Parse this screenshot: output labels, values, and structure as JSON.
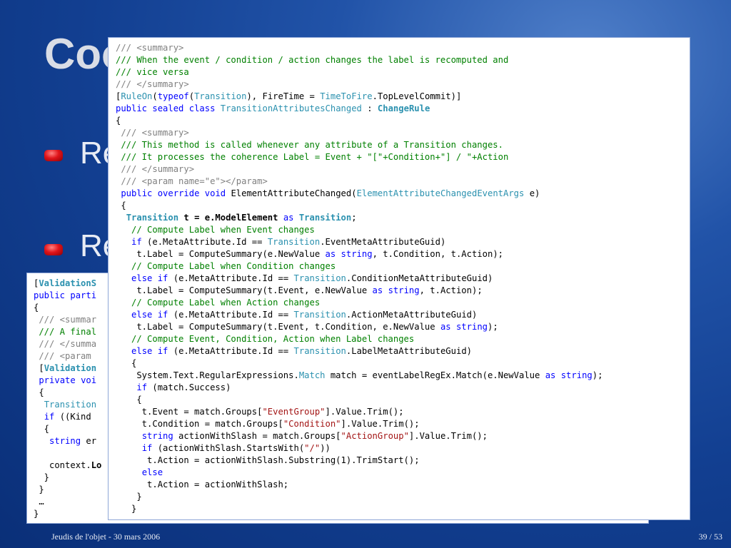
{
  "slide": {
    "title": "Coo",
    "bullets": [
      "Re",
      "Re"
    ],
    "footer_left": "Jeudis de l'objet - 30 mars 2006",
    "footer_right": "39 / 53"
  },
  "back_code": [
    [
      [
        "[",
        ""
      ],
      [
        "ValidationS",
        "bt"
      ]
    ],
    [
      [
        "public",
        "k"
      ],
      [
        " ",
        ""
      ],
      [
        "parti",
        "k"
      ]
    ],
    [
      [
        "{",
        ""
      ]
    ],
    [
      [
        " /// <summar",
        "x"
      ]
    ],
    [
      [
        " /// A final",
        "c"
      ]
    ],
    [
      [
        " /// </summa",
        "x"
      ]
    ],
    [
      [
        " /// <param ",
        "x"
      ]
    ],
    [
      [
        " [",
        ""
      ],
      [
        "Validation",
        "bt"
      ]
    ],
    [
      [
        " ",
        ""
      ],
      [
        "private",
        "k"
      ],
      [
        " ",
        ""
      ],
      [
        "voi",
        "k"
      ]
    ],
    [
      [
        " {",
        ""
      ]
    ],
    [
      [
        "  ",
        ""
      ],
      [
        "Transition",
        "t"
      ]
    ],
    [
      [
        "  ",
        ""
      ],
      [
        "if",
        "k"
      ],
      [
        " ((Kind ",
        ""
      ]
    ],
    [
      [
        "  {",
        ""
      ]
    ],
    [
      [
        "   ",
        ""
      ],
      [
        "string",
        "k"
      ],
      [
        " er",
        ""
      ]
    ],
    [
      [
        "",
        ""
      ]
    ],
    [
      [
        "   context.",
        ""
      ],
      [
        "Lo",
        "b"
      ]
    ],
    [
      [
        "  }",
        ""
      ]
    ],
    [
      [
        " }",
        ""
      ]
    ],
    [
      [
        " …",
        ""
      ]
    ],
    [
      [
        "}",
        ""
      ]
    ]
  ],
  "front_code": [
    [
      [
        "/// <summary>",
        "x"
      ]
    ],
    [
      [
        "/// When the event / condition / action changes the label is recomputed and",
        "c"
      ]
    ],
    [
      [
        "/// vice versa",
        "c"
      ]
    ],
    [
      [
        "/// </summary>",
        "x"
      ]
    ],
    [
      [
        "[",
        ""
      ],
      [
        "RuleOn",
        "t"
      ],
      [
        "(",
        ""
      ],
      [
        "typeof",
        "k"
      ],
      [
        "(",
        ""
      ],
      [
        "Transition",
        "t"
      ],
      [
        "), FireTime = ",
        ""
      ],
      [
        "TimeToFire",
        "t"
      ],
      [
        ".TopLevelCommit)]",
        ""
      ]
    ],
    [
      [
        "public",
        "k"
      ],
      [
        " ",
        ""
      ],
      [
        "sealed",
        "k"
      ],
      [
        " ",
        ""
      ],
      [
        "class",
        "k"
      ],
      [
        " ",
        ""
      ],
      [
        "TransitionAttributesChanged",
        "t"
      ],
      [
        " : ",
        ""
      ],
      [
        "ChangeRule",
        "bt"
      ]
    ],
    [
      [
        "{",
        ""
      ]
    ],
    [
      [
        " /// <summary>",
        "x"
      ]
    ],
    [
      [
        " /// This method is called whenever any attribute of a Transition changes.",
        "c"
      ]
    ],
    [
      [
        " /// It processes the coherence Label = Event + \"[\"+Condition+\"] / \"+Action",
        "c"
      ]
    ],
    [
      [
        " /// </summary>",
        "x"
      ]
    ],
    [
      [
        " /// <param name=\"e\"></param>",
        "x"
      ]
    ],
    [
      [
        " ",
        ""
      ],
      [
        "public",
        "k"
      ],
      [
        " ",
        ""
      ],
      [
        "override",
        "k"
      ],
      [
        " ",
        ""
      ],
      [
        "void",
        "k"
      ],
      [
        " ElementAttributeChanged(",
        ""
      ],
      [
        "ElementAttributeChangedEventArgs",
        "t"
      ],
      [
        " e)",
        ""
      ]
    ],
    [
      [
        " {",
        ""
      ]
    ],
    [
      [
        "  ",
        ""
      ],
      [
        "Transition",
        "bt"
      ],
      [
        " t = e.ModelElement ",
        "b"
      ],
      [
        "as",
        "k"
      ],
      [
        " ",
        ""
      ],
      [
        "Transition",
        "bt"
      ],
      [
        ";",
        ""
      ]
    ],
    [
      [
        "   // Compute Label when Event changes",
        "c"
      ]
    ],
    [
      [
        "   ",
        ""
      ],
      [
        "if",
        "k"
      ],
      [
        " (e.MetaAttribute.Id == ",
        ""
      ],
      [
        "Transition",
        "t"
      ],
      [
        ".EventMetaAttributeGuid)",
        ""
      ]
    ],
    [
      [
        "    t.Label = ComputeSummary(e.NewValue ",
        ""
      ],
      [
        "as",
        "k"
      ],
      [
        " ",
        ""
      ],
      [
        "string",
        "k"
      ],
      [
        ", t.Condition, t.Action);",
        ""
      ]
    ],
    [
      [
        "   // Compute Label when Condition changes",
        "c"
      ]
    ],
    [
      [
        "   ",
        ""
      ],
      [
        "else",
        "k"
      ],
      [
        " ",
        ""
      ],
      [
        "if",
        "k"
      ],
      [
        " (e.MetaAttribute.Id == ",
        ""
      ],
      [
        "Transition",
        "t"
      ],
      [
        ".ConditionMetaAttributeGuid)",
        ""
      ]
    ],
    [
      [
        "    t.Label = ComputeSummary(t.Event, e.NewValue ",
        ""
      ],
      [
        "as",
        "k"
      ],
      [
        " ",
        ""
      ],
      [
        "string",
        "k"
      ],
      [
        ", t.Action);",
        ""
      ]
    ],
    [
      [
        "   // Compute Label when Action changes",
        "c"
      ]
    ],
    [
      [
        "   ",
        ""
      ],
      [
        "else",
        "k"
      ],
      [
        " ",
        ""
      ],
      [
        "if",
        "k"
      ],
      [
        " (e.MetaAttribute.Id == ",
        ""
      ],
      [
        "Transition",
        "t"
      ],
      [
        ".ActionMetaAttributeGuid)",
        ""
      ]
    ],
    [
      [
        "    t.Label = ComputeSummary(t.Event, t.Condition, e.NewValue ",
        ""
      ],
      [
        "as",
        "k"
      ],
      [
        " ",
        ""
      ],
      [
        "string",
        "k"
      ],
      [
        ");",
        ""
      ]
    ],
    [
      [
        "   // Compute Event, Condition, Action when Label changes",
        "c"
      ]
    ],
    [
      [
        "   ",
        ""
      ],
      [
        "else",
        "k"
      ],
      [
        " ",
        ""
      ],
      [
        "if",
        "k"
      ],
      [
        " (e.MetaAttribute.Id == ",
        ""
      ],
      [
        "Transition",
        "t"
      ],
      [
        ".LabelMetaAttributeGuid)",
        ""
      ]
    ],
    [
      [
        "   {",
        ""
      ]
    ],
    [
      [
        "    System.Text.RegularExpressions.",
        ""
      ],
      [
        "Match",
        "t"
      ],
      [
        " match = eventLabelRegEx.Match(e.NewValue ",
        ""
      ],
      [
        "as",
        "k"
      ],
      [
        " ",
        ""
      ],
      [
        "string",
        "k"
      ],
      [
        ");",
        ""
      ]
    ],
    [
      [
        "    ",
        ""
      ],
      [
        "if",
        "k"
      ],
      [
        " (match.Success)",
        ""
      ]
    ],
    [
      [
        "    {",
        ""
      ]
    ],
    [
      [
        "     t.Event = match.Groups[",
        ""
      ],
      [
        "\"EventGroup\"",
        "s"
      ],
      [
        "].Value.Trim();",
        ""
      ]
    ],
    [
      [
        "     t.Condition = match.Groups[",
        ""
      ],
      [
        "\"Condition\"",
        "s"
      ],
      [
        "].Value.Trim();",
        ""
      ]
    ],
    [
      [
        "     ",
        ""
      ],
      [
        "string",
        "k"
      ],
      [
        " actionWithSlash = match.Groups[",
        ""
      ],
      [
        "\"ActionGroup\"",
        "s"
      ],
      [
        "].Value.Trim();",
        ""
      ]
    ],
    [
      [
        "     ",
        ""
      ],
      [
        "if",
        "k"
      ],
      [
        " (actionWithSlash.StartsWith(",
        ""
      ],
      [
        "\"/\"",
        "s"
      ],
      [
        "))",
        ""
      ]
    ],
    [
      [
        "      t.Action = actionWithSlash.Substring(1).TrimStart();",
        ""
      ]
    ],
    [
      [
        "     ",
        ""
      ],
      [
        "else",
        "k"
      ]
    ],
    [
      [
        "      t.Action = actionWithSlash;",
        ""
      ]
    ],
    [
      [
        "    }",
        ""
      ]
    ],
    [
      [
        "   }",
        ""
      ]
    ]
  ]
}
